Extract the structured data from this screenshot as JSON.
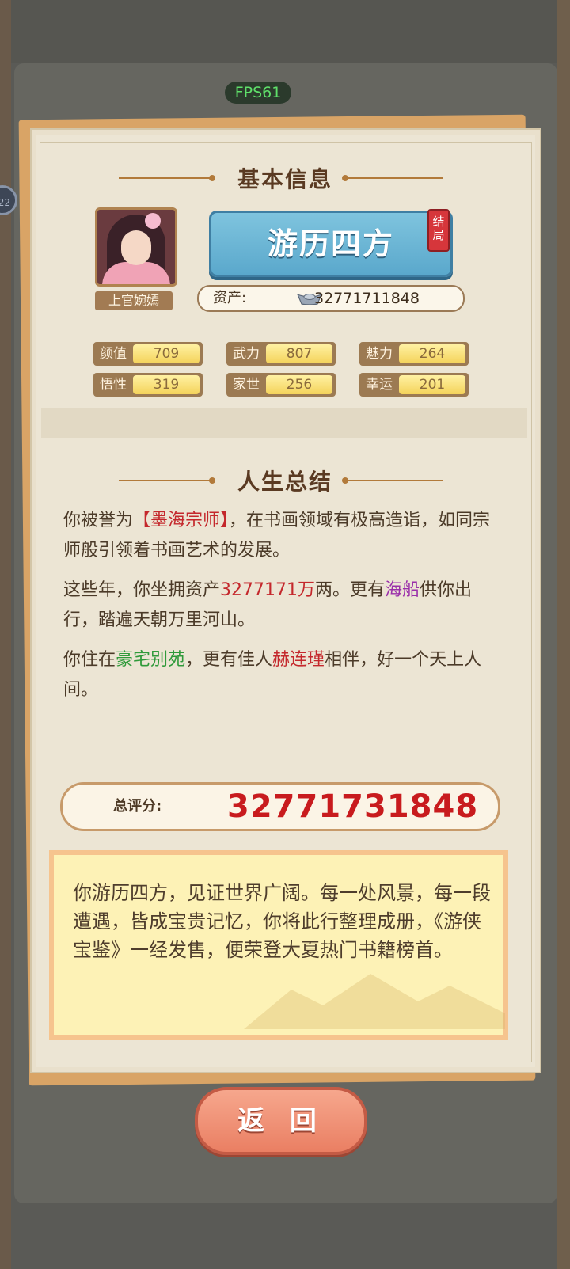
{
  "hud": {
    "fps": "FPS61",
    "side_badge": "22"
  },
  "basic_info": {
    "title": "基本信息",
    "character_name": "上官婉嫣",
    "ending_title": "游历四方",
    "ending_tag": "结局",
    "asset_label": "资产:",
    "asset_value": "32771711848",
    "stats": [
      {
        "label": "颜值",
        "value": "709"
      },
      {
        "label": "武力",
        "value": "807"
      },
      {
        "label": "魅力",
        "value": "264"
      },
      {
        "label": "悟性",
        "value": "319"
      },
      {
        "label": "家世",
        "value": "256"
      },
      {
        "label": "幸运",
        "value": "201"
      }
    ]
  },
  "life_summary": {
    "title": "人生总结",
    "p1": {
      "a": "你被誉为",
      "b": "【墨海宗师】",
      "c": "，在书画领域有极高造诣，如同宗师般引领着书画艺术的发展。"
    },
    "p2": {
      "a": "这些年，你坐拥资产",
      "b": "3277171万",
      "c": "两。更有",
      "d": "海船",
      "e": "供你出行，踏遍天朝万里河山。"
    },
    "p3": {
      "a": "你住在",
      "b": "豪宅别苑",
      "c": "，更有佳人",
      "d": "赫连瑾",
      "e": "相伴，好一个天上人间。"
    }
  },
  "score": {
    "label": "总评分:",
    "value": "32771731848"
  },
  "ending_text": "你游历四方，见证世界广阔。每一处风景，每一段遭遇，皆成宝贵记忆，你将此行整理成册，《游侠宝鉴》一经发售，便荣登大夏热门书籍榜首。",
  "return_button": "返 回",
  "colors": {
    "highlight_red": "#c4282c",
    "highlight_green": "#2f9a3a",
    "highlight_purple": "#9a2faa"
  }
}
